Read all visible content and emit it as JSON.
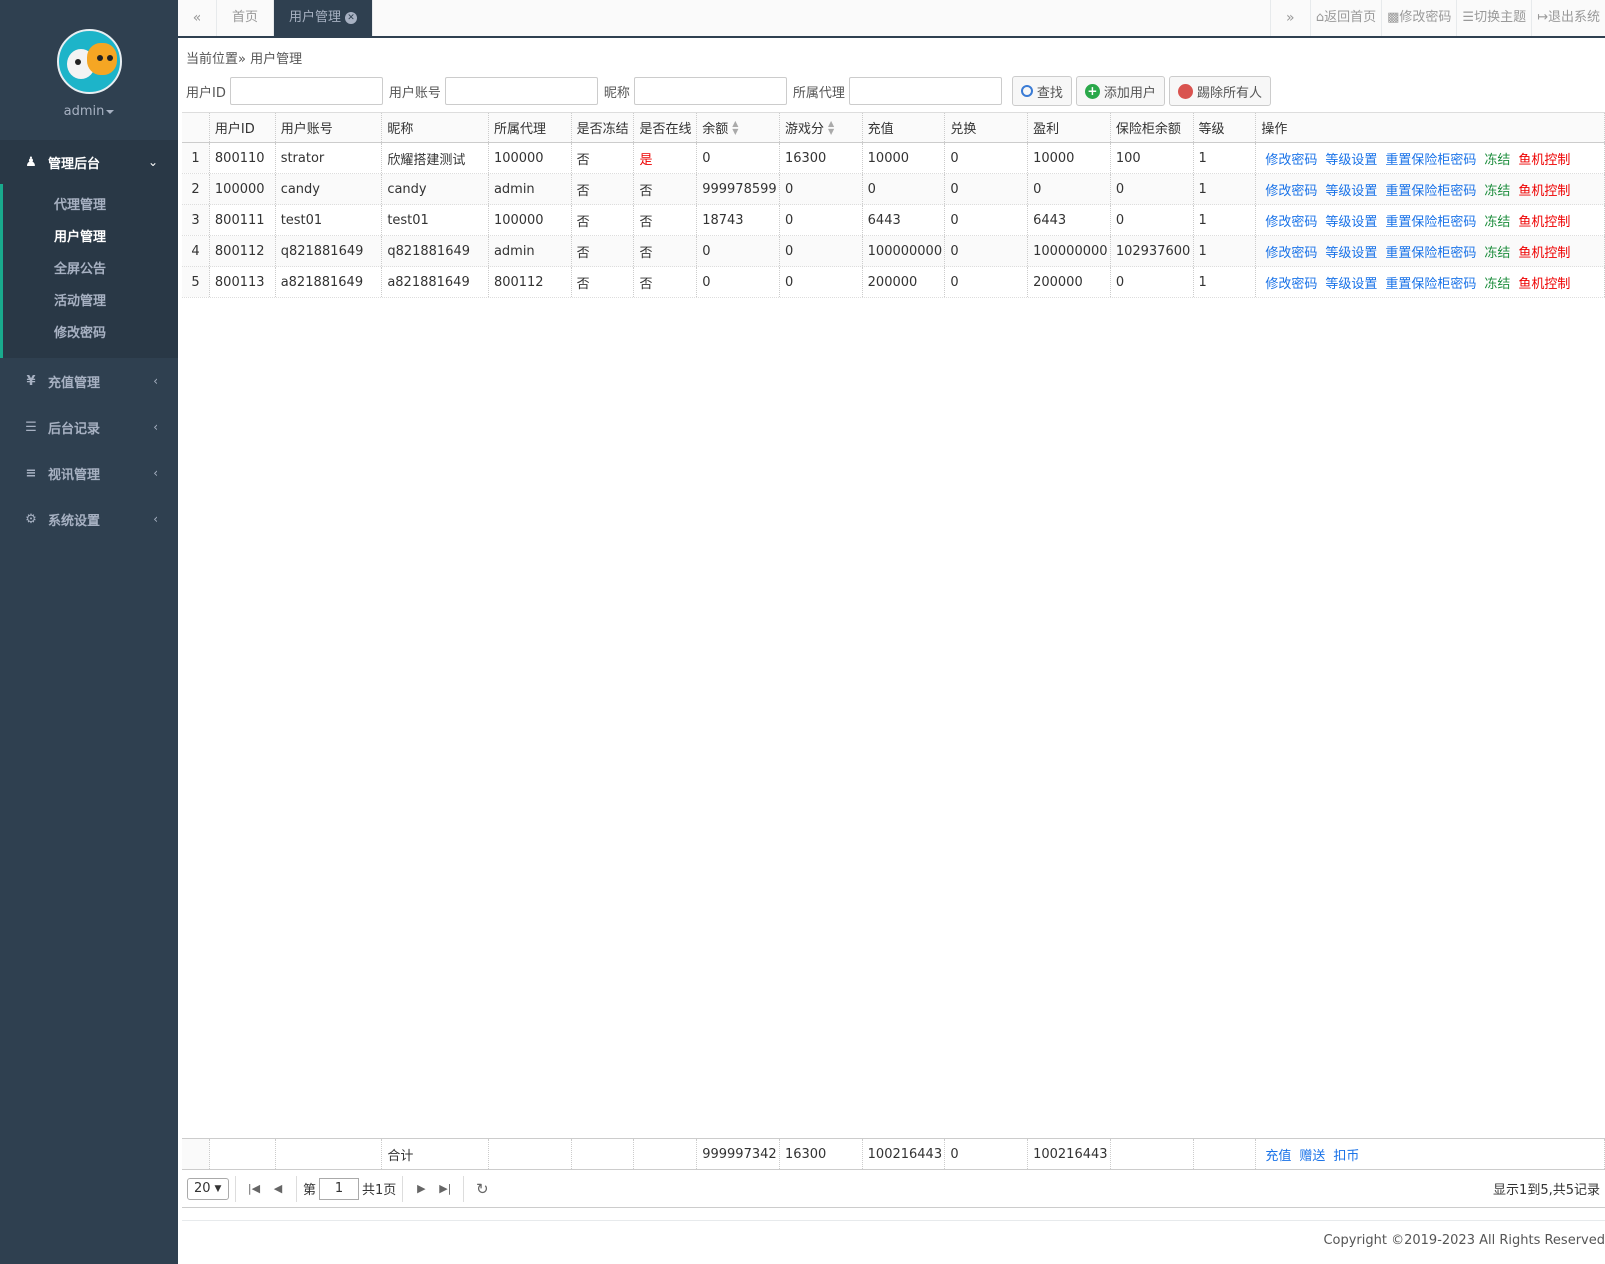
{
  "sidebar": {
    "user": "admin",
    "groups": [
      {
        "label": "管理后台",
        "icon": "users-icon",
        "items": [
          "代理管理",
          "用户管理",
          "全屏公告",
          "活动管理",
          "修改密码"
        ]
      },
      {
        "label": "充值管理",
        "icon": "yen-icon"
      },
      {
        "label": "后台记录",
        "icon": "list-icon"
      },
      {
        "label": "视讯管理",
        "icon": "list-alt-icon"
      },
      {
        "label": "系统设置",
        "icon": "cogs-icon"
      }
    ]
  },
  "topbar": {
    "prev": "«",
    "next": "»",
    "tabs": [
      "首页",
      "用户管理"
    ],
    "links": [
      "返回首页",
      "修改密码",
      "切换主题",
      "退出系统"
    ]
  },
  "breadcrumb": "当前位置» 用户管理",
  "search": {
    "fields": [
      "用户ID",
      "用户账号",
      "昵称",
      "所属代理"
    ],
    "buttons": [
      "查找",
      "添加用户",
      "踢除所有人"
    ]
  },
  "table": {
    "headers": [
      "用户ID",
      "用户账号",
      "昵称",
      "所属代理",
      "是否冻结",
      "是否在线",
      "余额",
      "游戏分",
      "充值",
      "兑换",
      "盈利",
      "保险柜余额",
      "等级",
      "操作"
    ],
    "rows": [
      [
        "1",
        "800110",
        "strator",
        "欣耀搭建测试",
        "100000",
        "否",
        "是",
        "0",
        "16300",
        "10000",
        "0",
        "10000",
        "100",
        "1"
      ],
      [
        "2",
        "100000",
        "candy",
        "candy",
        "admin",
        "否",
        "否",
        "999978599",
        "0",
        "0",
        "0",
        "0",
        "0",
        "1"
      ],
      [
        "3",
        "800111",
        "test01",
        "test01",
        "100000",
        "否",
        "否",
        "18743",
        "0",
        "6443",
        "0",
        "6443",
        "0",
        "1"
      ],
      [
        "4",
        "800112",
        "q821881649",
        "q821881649",
        "admin",
        "否",
        "否",
        "0",
        "0",
        "100000000",
        "0",
        "100000000",
        "102937600",
        "1"
      ],
      [
        "5",
        "800113",
        "a821881649",
        "a821881649",
        "800112",
        "否",
        "否",
        "0",
        "0",
        "200000",
        "0",
        "200000",
        "0",
        "1"
      ]
    ],
    "actions": [
      "修改密码",
      "等级设置",
      "重置保险柜密码",
      "冻结",
      "鱼机控制"
    ],
    "footer": {
      "label": "合计",
      "balance": "999997342",
      "score": "16300",
      "recharge": "100216443",
      "exchange": "0",
      "profit": "100216443",
      "actions": [
        "充值",
        "赠送",
        "扣币"
      ]
    }
  },
  "pager": {
    "page_size": "20",
    "page_prefix": "第",
    "page": "1",
    "total_pages": "共1页",
    "info": "显示1到5,共5记录"
  },
  "copyright": "Copyright ©2019-2023  All Rights Reserved"
}
